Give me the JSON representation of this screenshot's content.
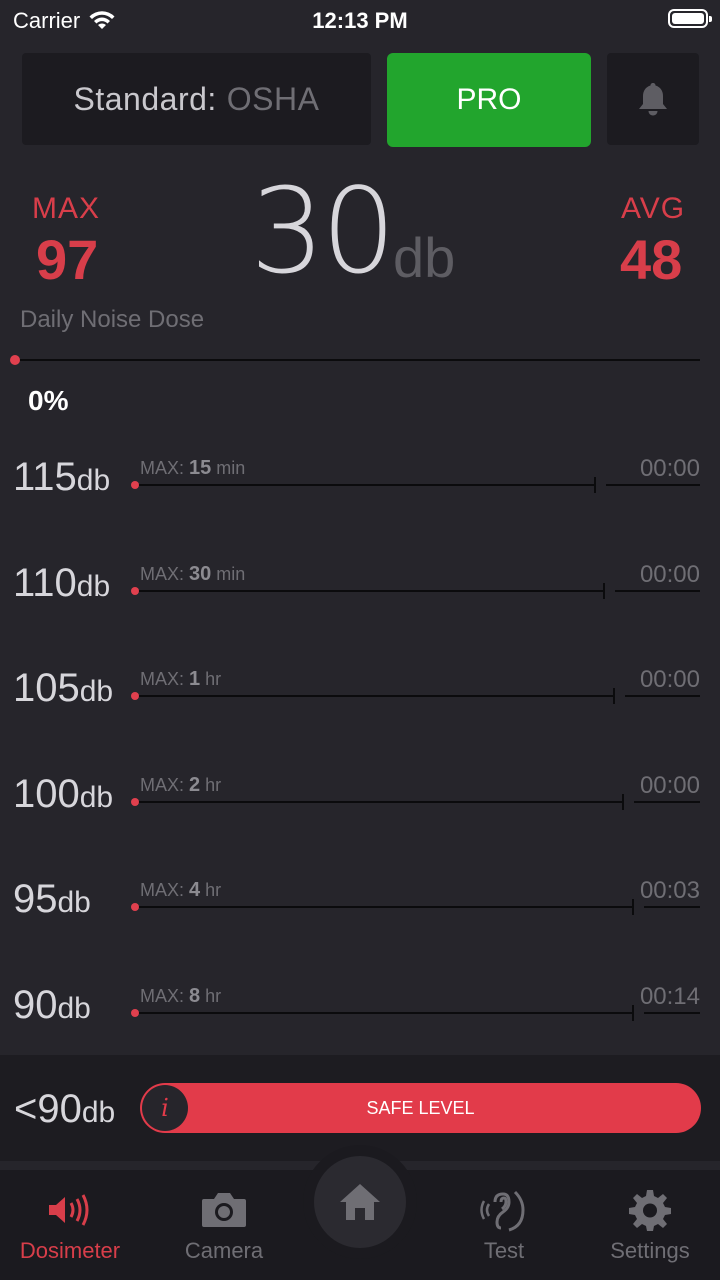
{
  "status_bar": {
    "carrier": "Carrier",
    "time": "12:13 PM"
  },
  "header": {
    "standard_label": "Standard:",
    "standard_value": "OSHA",
    "pro_label": "PRO",
    "bell_icon": "bell-icon"
  },
  "meter": {
    "max_label": "MAX",
    "max_value": "97",
    "current_value": "30",
    "current_unit": "db",
    "avg_label": "AVG",
    "avg_value": "48"
  },
  "dose": {
    "label": "Daily Noise Dose",
    "percent": "0%",
    "progress": 0
  },
  "levels": [
    {
      "level": "115",
      "unit": "db",
      "max_prefix": "MAX:",
      "max_amount": "15",
      "max_unit": "min",
      "time": "00:00"
    },
    {
      "level": "110",
      "unit": "db",
      "max_prefix": "MAX:",
      "max_amount": "30",
      "max_unit": "min",
      "time": "00:00"
    },
    {
      "level": "105",
      "unit": "db",
      "max_prefix": "MAX:",
      "max_amount": "1",
      "max_unit": "hr",
      "time": "00:00"
    },
    {
      "level": "100",
      "unit": "db",
      "max_prefix": "MAX:",
      "max_amount": "2",
      "max_unit": "hr",
      "time": "00:00"
    },
    {
      "level": "95",
      "unit": "db",
      "max_prefix": "MAX:",
      "max_amount": "4",
      "max_unit": "hr",
      "time": "00:03"
    },
    {
      "level": "90",
      "unit": "db",
      "max_prefix": "MAX:",
      "max_amount": "8",
      "max_unit": "hr",
      "time": "00:14"
    }
  ],
  "safe": {
    "level": "<90",
    "unit": "db",
    "label": "SAFE LEVEL",
    "info_icon_text": "i"
  },
  "tabs": [
    {
      "label": "Dosimeter",
      "icon": "speaker-icon",
      "active": true
    },
    {
      "label": "Camera",
      "icon": "camera-icon",
      "active": false
    },
    {
      "label": "",
      "icon": "home-icon",
      "active": false
    },
    {
      "label": "Test",
      "icon": "ear-icon",
      "active": false
    },
    {
      "label": "Settings",
      "icon": "gear-icon",
      "active": false
    }
  ],
  "colors": {
    "accent": "#d83e4a",
    "pro": "#22a52d",
    "background": "#26252b"
  }
}
